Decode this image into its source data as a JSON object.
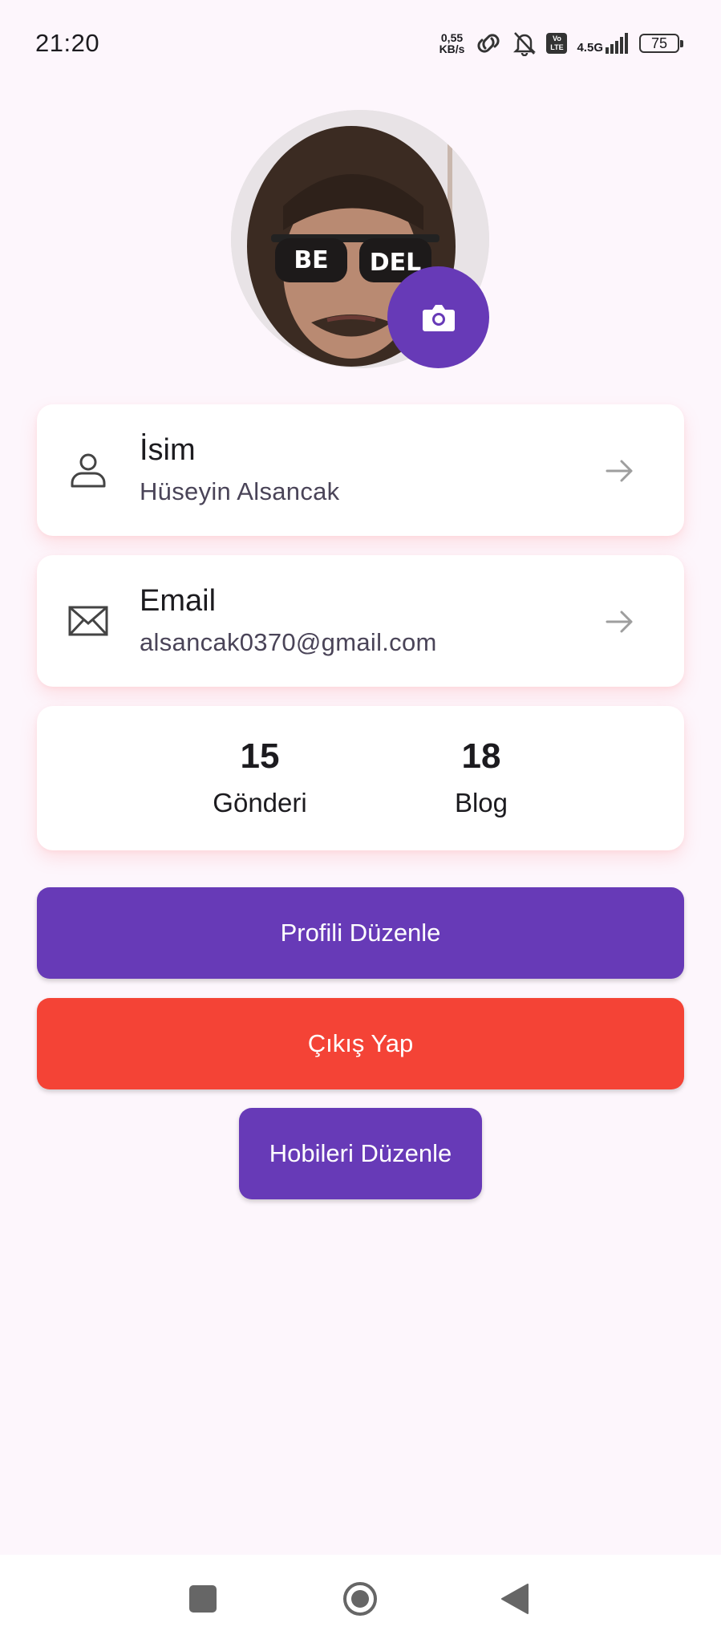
{
  "status_bar": {
    "time": "21:20",
    "net_speed_value": "0,55",
    "net_speed_unit": "KB/s",
    "volte": "Vo LTE",
    "network_type": "4.5G",
    "battery": "75",
    "icons": [
      "link-icon",
      "bell-off-icon",
      "volte-icon",
      "signal-icon",
      "battery-icon"
    ]
  },
  "profile": {
    "avatar_overlay_text": "BE DEL",
    "camera_icon": "camera-icon"
  },
  "name_row": {
    "icon": "person-icon",
    "title": "İsim",
    "value": "Hüseyin Alsancak",
    "arrow_icon": "arrow-right-icon"
  },
  "email_row": {
    "icon": "mail-icon",
    "title": "Email",
    "value": "alsancak0370@gmail.com",
    "arrow_icon": "arrow-right-icon"
  },
  "stats": [
    {
      "value": "15",
      "label": "Gönderi"
    },
    {
      "value": "18",
      "label": "Blog"
    }
  ],
  "buttons": {
    "edit_profile": "Profili Düzenle",
    "logout": "Çıkış Yap",
    "edit_hobbies": "Hobileri Düzenle"
  },
  "colors": {
    "primary": "#673ab7",
    "danger": "#f44336",
    "background": "#fdf6fc"
  },
  "nav_bar": {
    "icons": [
      "square-icon",
      "home-circle-icon",
      "back-triangle-icon"
    ]
  }
}
